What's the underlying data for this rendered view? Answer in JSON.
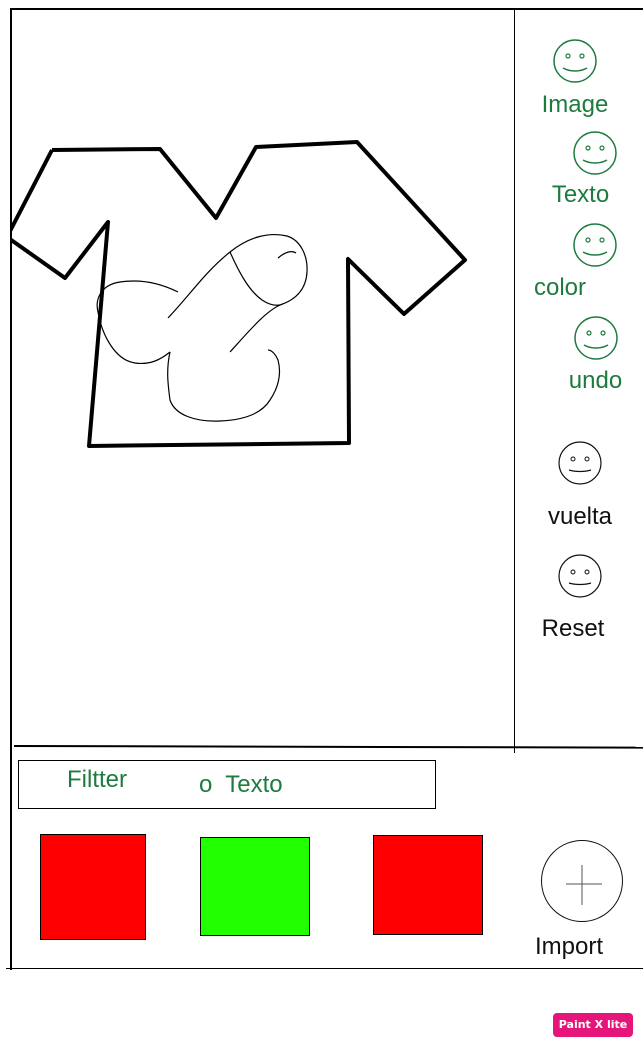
{
  "sidebar": {
    "tools": [
      {
        "label": "Image",
        "icon": "smiley-icon",
        "color": "#1e7b3f"
      },
      {
        "label": "Texto",
        "icon": "smiley-icon",
        "color": "#1e7b3f"
      },
      {
        "label": "color",
        "icon": "smiley-icon",
        "color": "#1e7b3f"
      },
      {
        "label": "undo",
        "icon": "smiley-icon",
        "color": "#1e7b3f"
      },
      {
        "label": "vuelta",
        "icon": "smiley-icon",
        "color": "#111111"
      },
      {
        "label": "Reset",
        "icon": "smiley-icon",
        "color": "#111111"
      }
    ]
  },
  "filter": {
    "label": "Filtter",
    "text_option": "o  Texto"
  },
  "swatches": [
    {
      "name": "red",
      "color": "#ff0000"
    },
    {
      "name": "green",
      "color": "#22ff00"
    },
    {
      "name": "red",
      "color": "#ff0000"
    }
  ],
  "import": {
    "label": "Import",
    "icon": "plus-icon"
  },
  "canvas": {
    "content": "t-shirt drawing with doodle",
    "icon": "tshirt-icon"
  },
  "watermark": {
    "text": "Paint X lite",
    "color": "#e6157a"
  }
}
